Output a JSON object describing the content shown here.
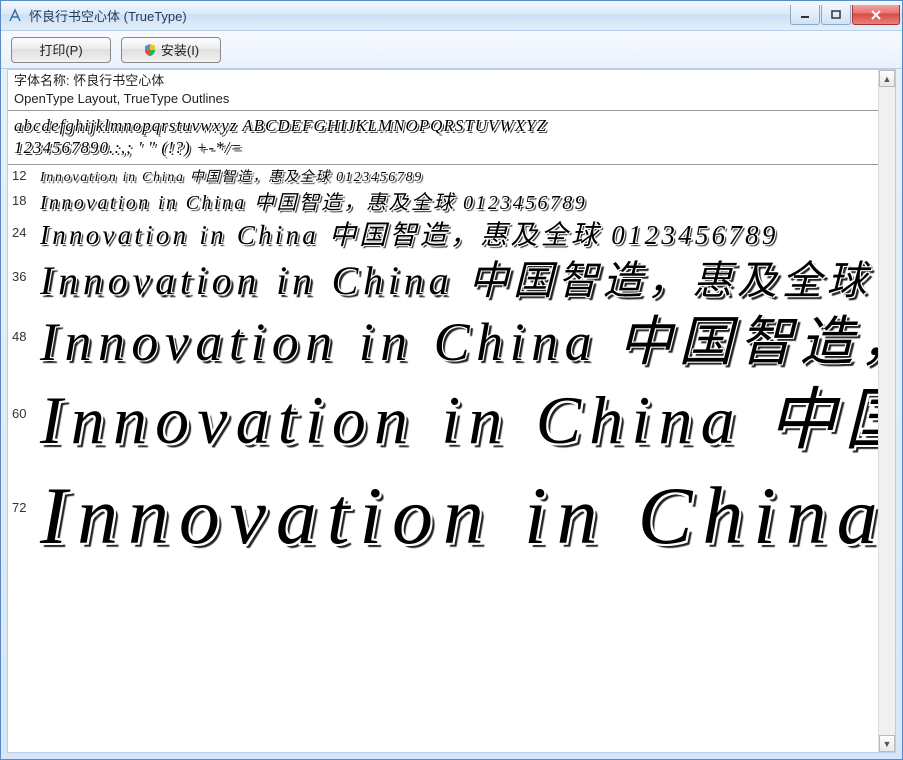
{
  "window": {
    "title": "怀良行书空心体 (TrueType)"
  },
  "toolbar": {
    "print_label": "打印(P)",
    "install_label": "安装(I)"
  },
  "font_meta": {
    "name_label": "字体名称: 怀良行书空心体",
    "tech_line": "OpenType Layout, TrueType Outlines"
  },
  "glyphs": {
    "line1": "abcdefghijklmnopqrstuvwxyz ABCDEFGHIJKLMNOPQRSTUVWXYZ",
    "line2": "1234567890.:,; ' \" (!?) +-*/="
  },
  "sample_text": "Innovation in China 中国智造，惠及全球 0123456789",
  "sizes": [
    {
      "label": "12",
      "class": "s12"
    },
    {
      "label": "18",
      "class": "s18"
    },
    {
      "label": "24",
      "class": "s24"
    },
    {
      "label": "36",
      "class": "s36"
    },
    {
      "label": "48",
      "class": "s48"
    },
    {
      "label": "60",
      "class": "s60"
    },
    {
      "label": "72",
      "class": "s72"
    }
  ]
}
